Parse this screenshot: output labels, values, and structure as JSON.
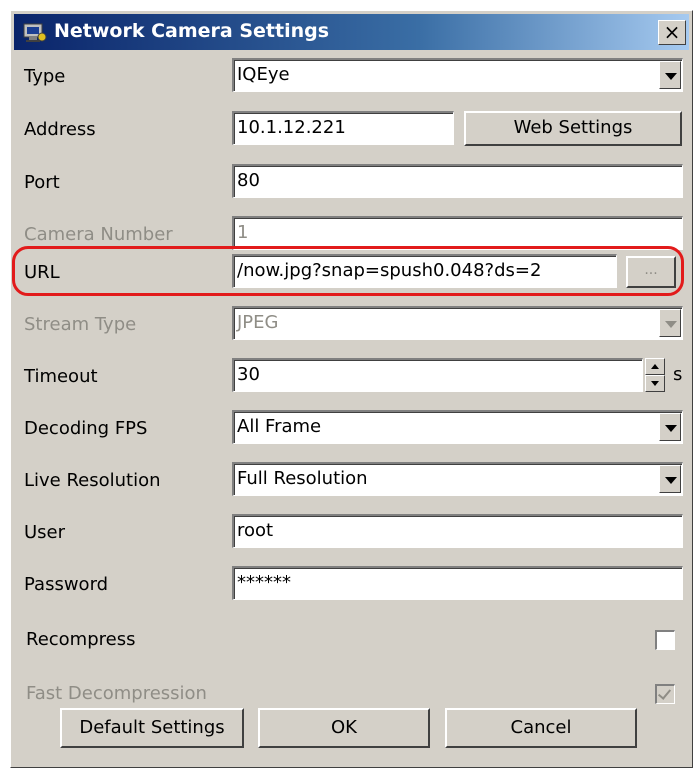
{
  "window": {
    "title": "Network Camera Settings",
    "close_label": "×",
    "accent": "#0a246a"
  },
  "fields": {
    "type": {
      "label": "Type",
      "value": "IQEye"
    },
    "address": {
      "label": "Address",
      "value": "10.1.12.221",
      "button": "Web Settings"
    },
    "port": {
      "label": "Port",
      "value": "80"
    },
    "camera_number": {
      "label": "Camera Number",
      "value": "1"
    },
    "url": {
      "label": "URL",
      "value": "/now.jpg?snap=spush0.048?ds=2",
      "button": "..."
    },
    "stream_type": {
      "label": "Stream Type",
      "value": "JPEG"
    },
    "timeout": {
      "label": "Timeout",
      "value": "30",
      "unit": "s"
    },
    "decoding_fps": {
      "label": "Decoding FPS",
      "value": "All Frame"
    },
    "live_resolution": {
      "label": "Live Resolution",
      "value": "Full Resolution"
    },
    "user": {
      "label": "User",
      "value": "root"
    },
    "password": {
      "label": "Password",
      "value": "******"
    }
  },
  "options": {
    "recompress": {
      "label": "Recompress",
      "checked": false
    },
    "fast_decompression": {
      "label": "Fast Decompression",
      "checked": true,
      "disabled": true
    }
  },
  "buttons": {
    "default": "Default Settings",
    "ok": "OK",
    "cancel": "Cancel"
  },
  "highlight_color": "#e21b1b"
}
